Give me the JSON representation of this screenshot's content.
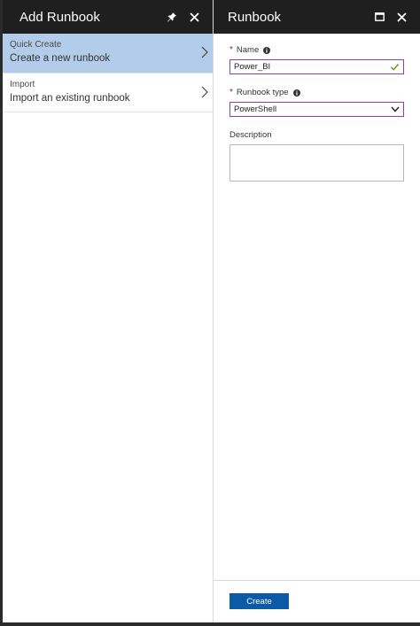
{
  "left_blade": {
    "title": "Add Runbook",
    "items": [
      {
        "title": "Quick Create",
        "subtitle": "Create a new runbook"
      },
      {
        "title": "Import",
        "subtitle": "Import an existing runbook"
      }
    ]
  },
  "right_blade": {
    "title": "Runbook",
    "fields": {
      "name_label": "Name",
      "name_value": "Power_BI",
      "type_label": "Runbook type",
      "type_value": "PowerShell",
      "description_label": "Description"
    },
    "create_label": "Create"
  },
  "icons": {
    "pin": "pin-icon",
    "close": "close-icon",
    "maximize": "maximize-icon",
    "chevron": "chevron-right-icon",
    "info": "info-icon",
    "check": "check-icon",
    "dropdown": "chevron-down-icon"
  },
  "colors": {
    "header": "#1f1f1f",
    "selected": "#b2ccea",
    "accent": "#0b5aa6",
    "input_border": "#9b3aa0",
    "check": "#5aa40f"
  }
}
